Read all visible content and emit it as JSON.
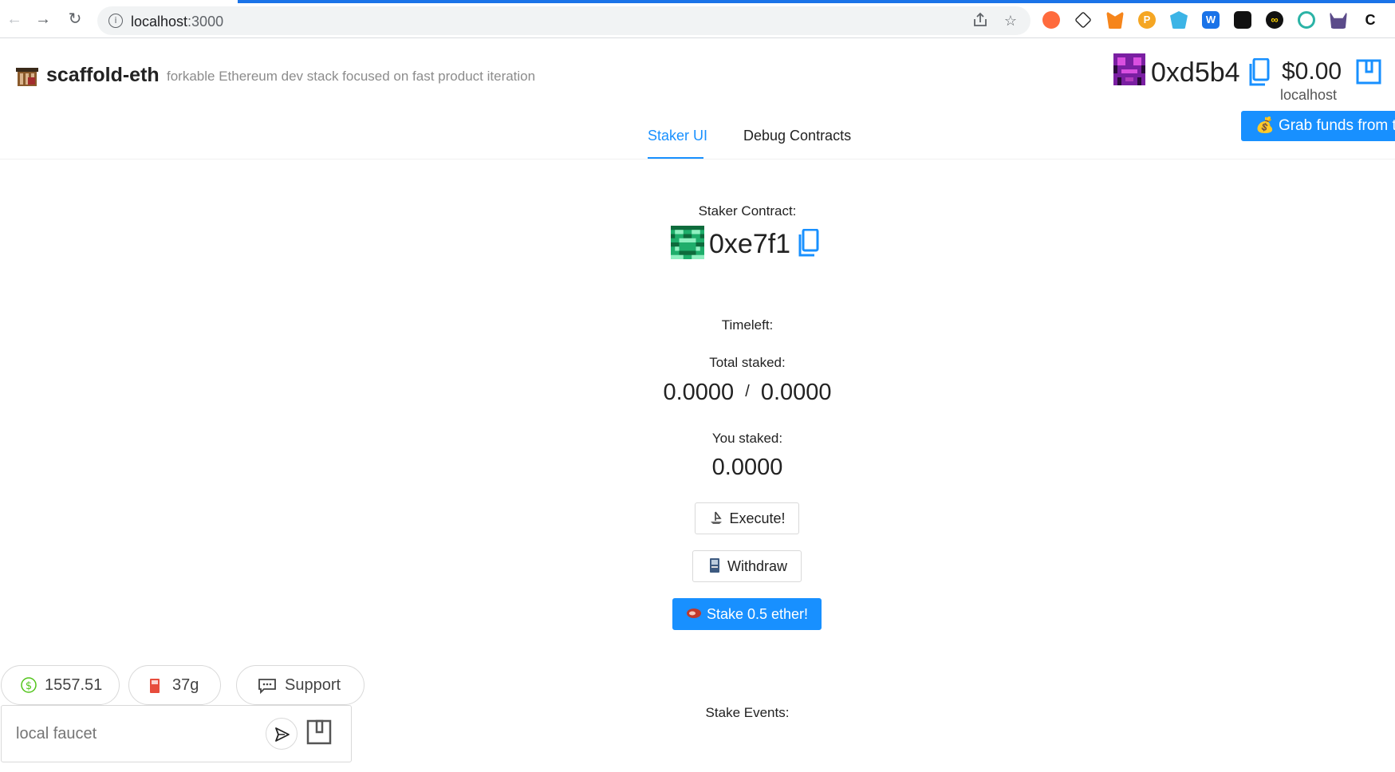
{
  "browser": {
    "url_host": "localhost",
    "url_port": ":3000",
    "nav": {
      "back": "←",
      "forward": "→",
      "reload": "↻"
    },
    "icons": [
      "share-icon",
      "star-icon"
    ]
  },
  "header": {
    "brand": "scaffold-eth",
    "tagline": "forkable Ethereum dev stack focused on fast product iteration"
  },
  "account": {
    "address": "0xd5b4",
    "balance": "$0.00",
    "network": "localhost"
  },
  "grab_funds": {
    "emoji": "💰",
    "label": "Grab funds from th"
  },
  "tabs": [
    {
      "label": "Staker UI",
      "active": true
    },
    {
      "label": "Debug Contracts",
      "active": false
    }
  ],
  "main": {
    "contract_label": "Staker Contract:",
    "contract_address": "0xe7f1",
    "timeleft_label": "Timeleft:",
    "total_staked_label": "Total staked:",
    "total_staked": "0.0000",
    "threshold": "0.0000",
    "separator": "/",
    "you_staked_label": "You staked:",
    "you_staked": "0.0000",
    "execute_label": "Execute!",
    "withdraw_label": "Withdraw",
    "stake_label": "Stake 0.5 ether!",
    "events_label": "Stake Events:"
  },
  "footer": {
    "price": "1557.51",
    "gas": "37g",
    "support": "Support",
    "faucet_placeholder": "local faucet"
  },
  "colors": {
    "accent": "#1890ff",
    "chrome_loadbar": "#1a73e8"
  }
}
